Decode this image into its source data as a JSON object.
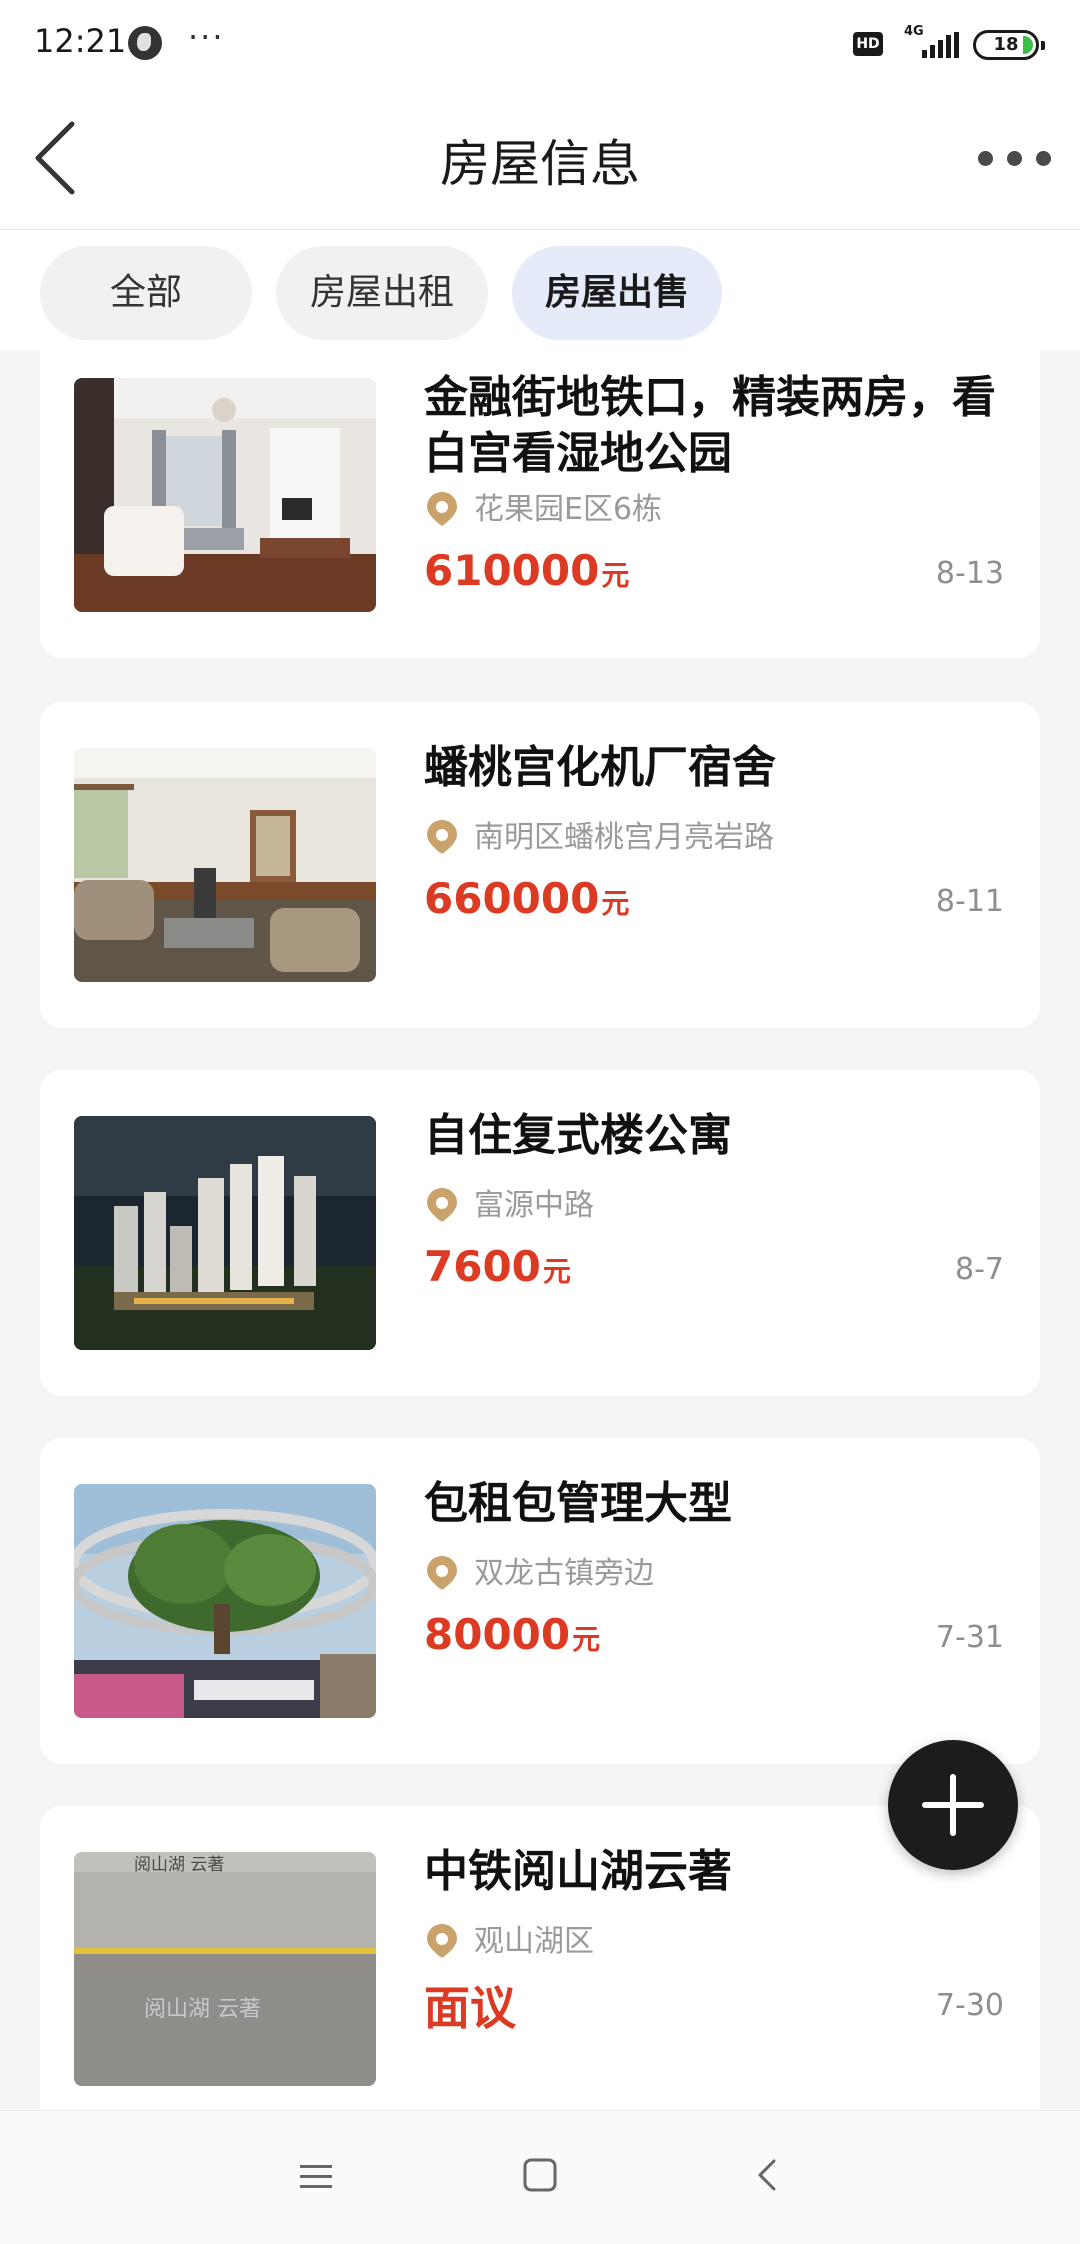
{
  "status_bar": {
    "time": "12:21",
    "overflow": "···",
    "hd_badge": "HD",
    "network": "4G",
    "battery": "18"
  },
  "header": {
    "title": "房屋信息",
    "back_icon": "chevron-left-icon",
    "more_icon": "more-horizontal-icon"
  },
  "tabs": [
    {
      "label": "全部",
      "active": false
    },
    {
      "label": "房屋出租",
      "active": false
    },
    {
      "label": "房屋出售",
      "active": true
    }
  ],
  "listings": [
    {
      "title": "金融街地铁口，精装两房，看白宫看湿地公园",
      "location": "花果园E区6栋",
      "price": "610000",
      "unit": "元",
      "date": "8-13",
      "image": "living-room-photo"
    },
    {
      "title": "蟠桃宫化机厂宿舍",
      "location": "南明区蟠桃宫月亮岩路",
      "price": "660000",
      "unit": "元",
      "date": "8-11",
      "image": "sofa-room-photo"
    },
    {
      "title": "自住复式楼公寓",
      "location": "富源中路",
      "price": "7600",
      "unit": "元",
      "date": "8-7",
      "image": "night-towers-photo"
    },
    {
      "title": "包租包管理大型",
      "location": "双龙古镇旁边",
      "price": "80000",
      "unit": "元",
      "date": "7-31",
      "image": "plaza-tree-photo"
    },
    {
      "title": "中铁阅山湖云著",
      "location": "观山湖区",
      "price": "面议",
      "unit": "",
      "date": "7-30",
      "image": "concrete-wall-photo",
      "photo_text": "阅山湖 云著"
    }
  ],
  "fab": {
    "icon": "plus-icon"
  },
  "system_nav": {
    "icons": [
      "menu-icon",
      "home-square-icon",
      "back-triangle-icon"
    ]
  },
  "colors": {
    "price": "#dc3a22",
    "pin": "#c9a36b",
    "active_tab": "#e5ebf8",
    "fab": "#1c1c1c"
  }
}
